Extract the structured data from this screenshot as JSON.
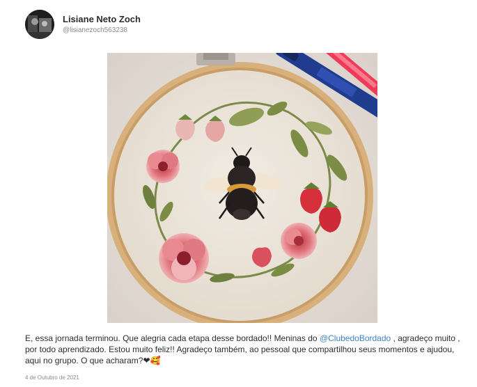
{
  "author": {
    "name": "Lisiane Neto Zoch",
    "handle": "@lisianezoch563238"
  },
  "post": {
    "image_icon": "embroidery-hoop-bee-photo",
    "caption_part1": "E, essa jornada terminou.  Que alegria cada etapa desse bordado!! Meninas do ",
    "mention": "@ClubedoBordado",
    "caption_part2": " , agradeço muito , por todo aprendizado.  Estou muito feliz!! Agradeço também, ao pessoal que compartilhou seus momentos e ajudou, aqui no grupo.  O que acharam?❤🥰",
    "date": "4 de Outubro de 2021"
  },
  "colors": {
    "mention": "#3c7fc1",
    "name": "#2b2b2b",
    "meta": "#8a8a8a"
  }
}
